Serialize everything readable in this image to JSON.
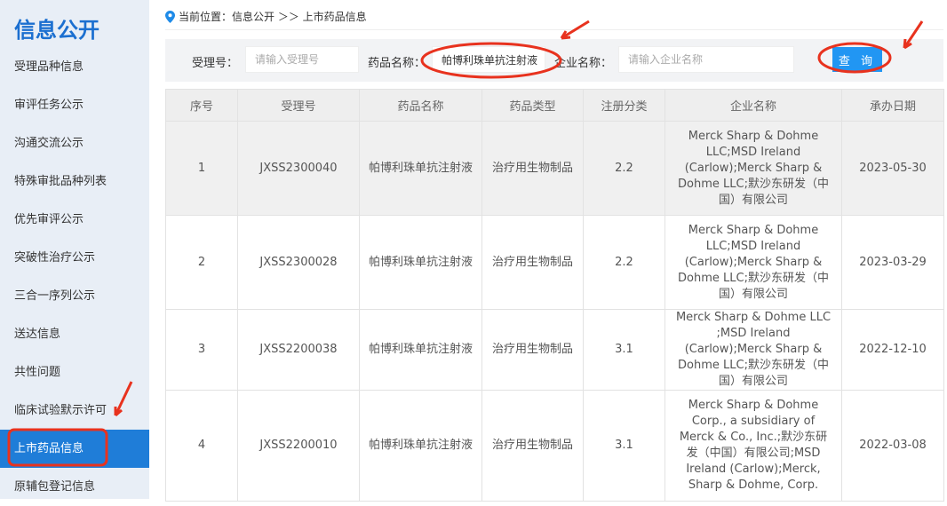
{
  "sidebar": {
    "title": "信息公开",
    "items": [
      "受理品种信息",
      "审评任务公示",
      "沟通交流公示",
      "特殊审批品种列表",
      "优先审评公示",
      "突破性治疗公示",
      "三合一序列公示",
      "送达信息",
      "共性问题",
      "临床试验默示许可",
      "上市药品信息",
      "原辅包登记信息"
    ],
    "active_index": 10
  },
  "breadcrumb": {
    "label": "当前位置：信息公开 ＞＞ 上市药品信息"
  },
  "search": {
    "accept_label": "受理号：",
    "accept_placeholder": "请输入受理号",
    "drug_label": "药品名称：",
    "drug_value": "帕博利珠单抗注射液",
    "company_label": "企业名称：",
    "company_placeholder": "请输入企业名称",
    "query_button": "查 询"
  },
  "table": {
    "headers": [
      "序号",
      "受理号",
      "药品名称",
      "药品类型",
      "注册分类",
      "企业名称",
      "承办日期"
    ],
    "rows": [
      [
        "1",
        "JXSS2300040",
        "帕博利珠单抗注射液",
        "治疗用生物制品",
        "2.2",
        "Merck Sharp & Dohme LLC;MSD Ireland (Carlow);Merck Sharp & Dohme LLC;默沙东研发（中国）有限公司",
        "2023-05-30"
      ],
      [
        "2",
        "JXSS2300028",
        "帕博利珠单抗注射液",
        "治疗用生物制品",
        "2.2",
        "Merck Sharp & Dohme LLC;MSD Ireland (Carlow);Merck Sharp & Dohme LLC;默沙东研发（中国）有限公司",
        "2023-03-29"
      ],
      [
        "3",
        "JXSS2200038",
        "帕博利珠单抗注射液",
        "治疗用生物制品",
        "3.1",
        "Merck Sharp & Dohme LLC ;MSD Ireland (Carlow);Merck Sharp & Dohme LLC;默沙东研发（中国）有限公司",
        "2022-12-10"
      ],
      [
        "4",
        "JXSS2200010",
        "帕博利珠单抗注射液",
        "治疗用生物制品",
        "3.1",
        "Merck Sharp & Dohme Corp., a subsidiary of Merck & Co., Inc.;默沙东研发（中国）有限公司;MSD Ireland (Carlow);Merck, Sharp & Dohme, Corp.",
        "2022-03-08"
      ]
    ]
  },
  "colors": {
    "accent": "#1f7dd8",
    "button": "#2196f3",
    "annotation": "#e8321e"
  }
}
